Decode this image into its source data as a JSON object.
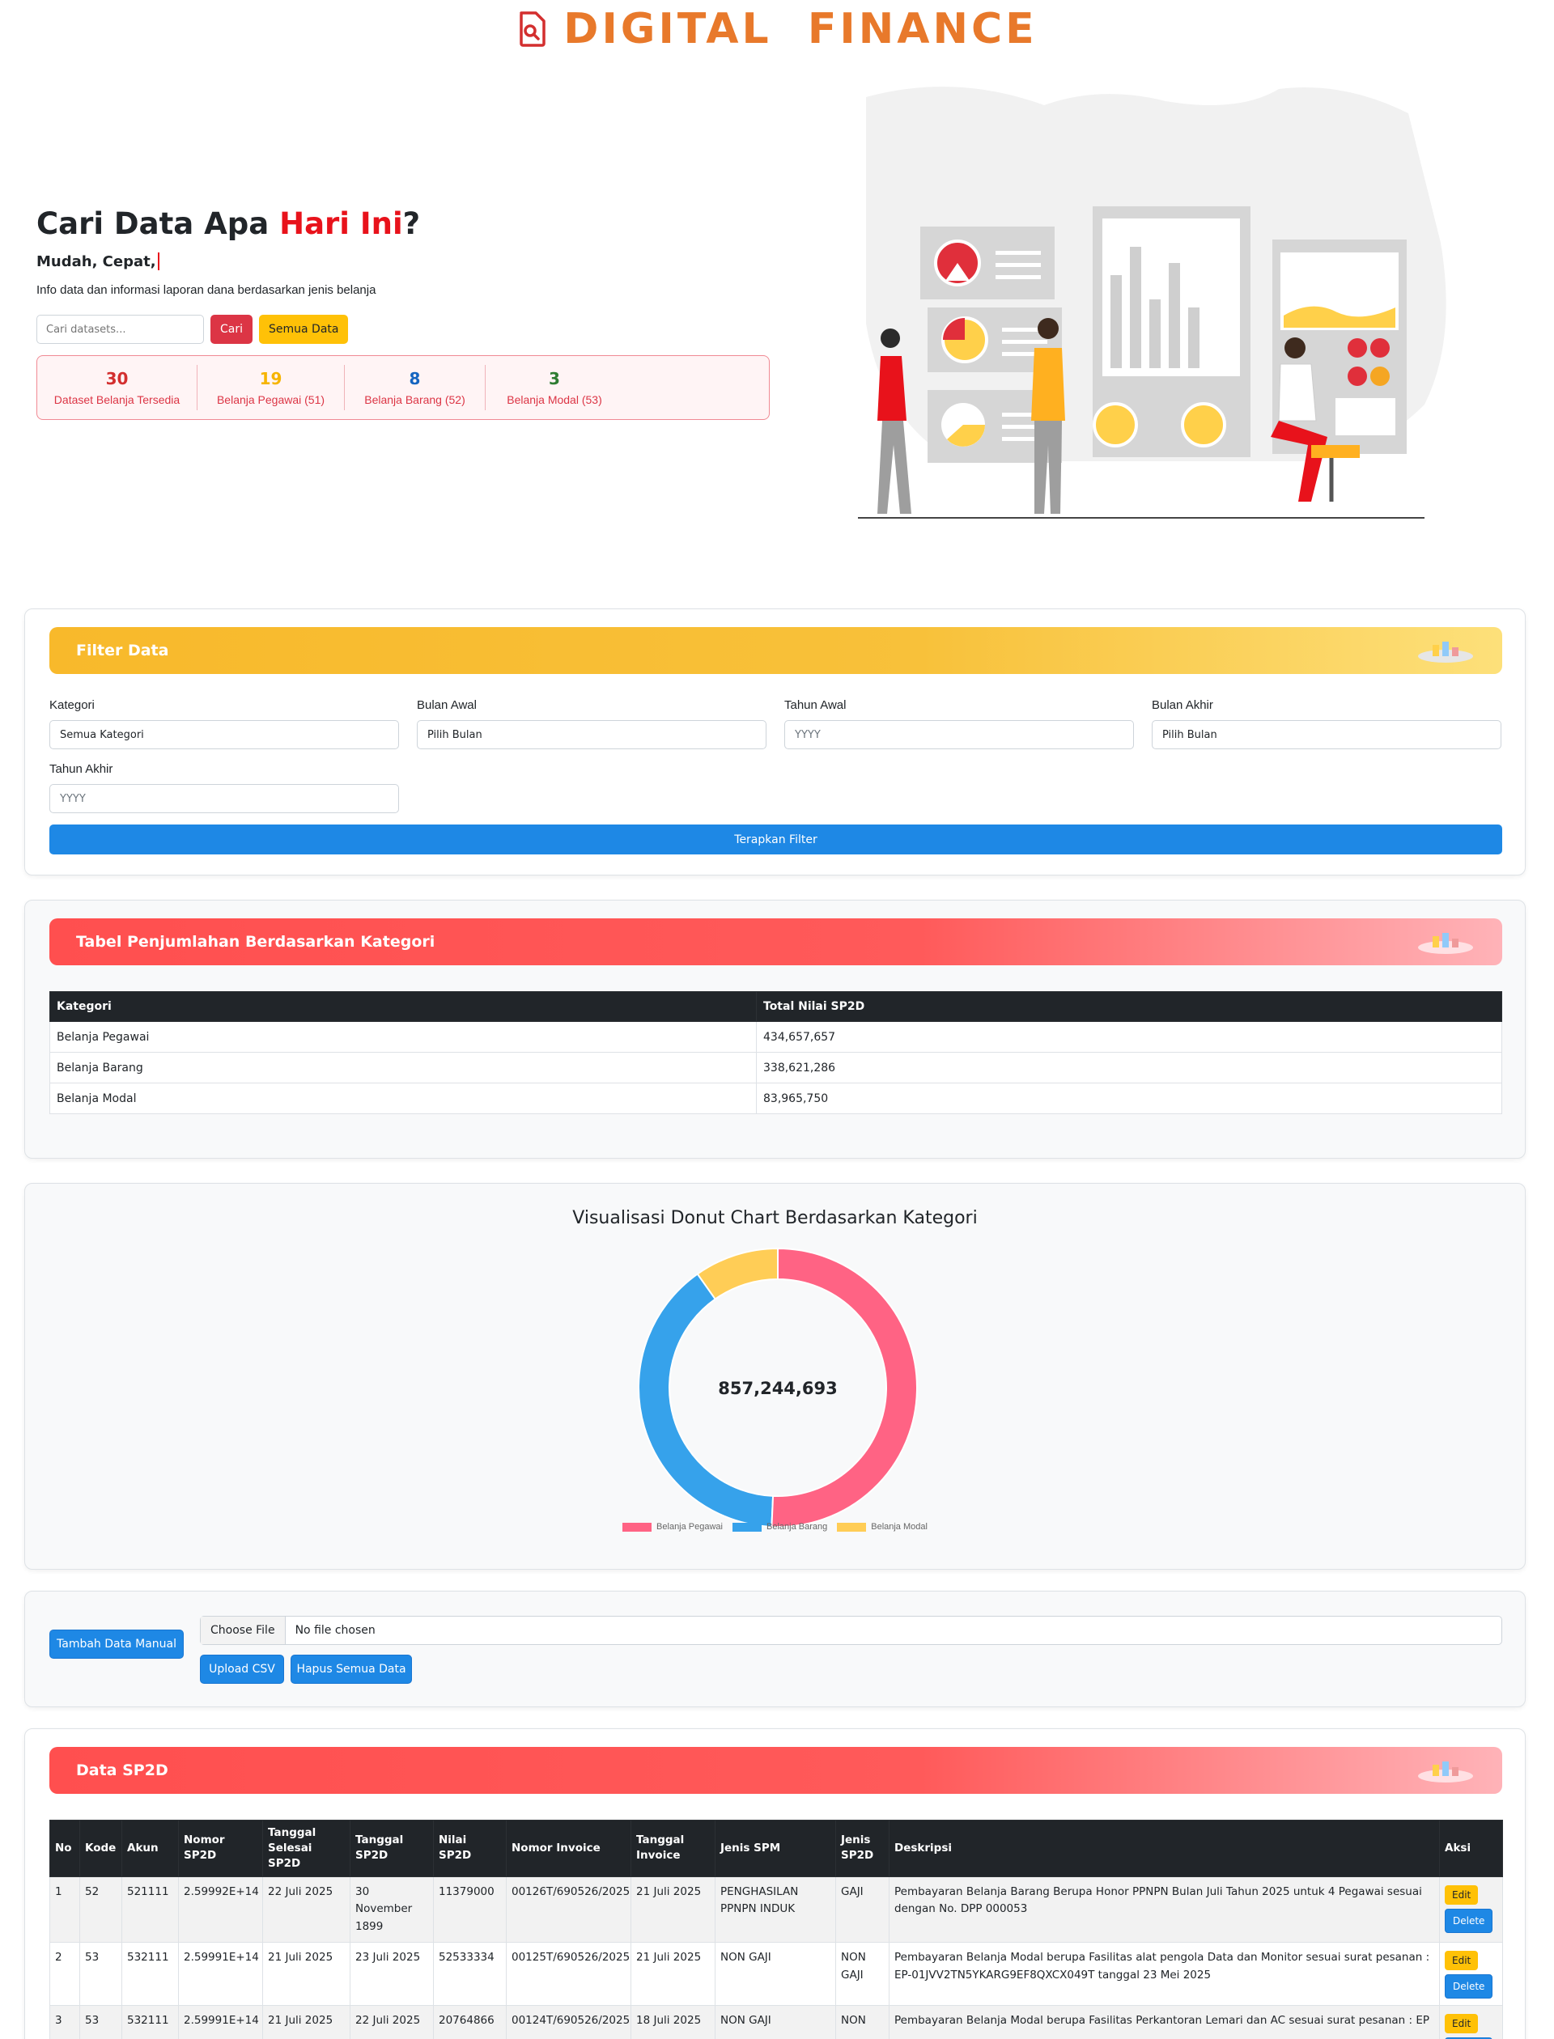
{
  "brand": {
    "title": "DIGITAL  FINANCE"
  },
  "hero": {
    "title_prefix": "Cari Data Apa ",
    "title_highlight": "Hari Ini",
    "title_suffix": "?",
    "typed_text": "Mudah, Cepat,",
    "description": "Info data dan informasi laporan dana berdasarkan jenis belanja",
    "search_placeholder": "Cari datasets...",
    "search_button": "Cari",
    "all_data_button": "Semua Data"
  },
  "stats": [
    {
      "value": "30",
      "label": "Dataset Belanja Tersedia",
      "color": "#d32f2f"
    },
    {
      "value": "19",
      "label": "Belanja Pegawai (51)",
      "color": "#f6b400"
    },
    {
      "value": "8",
      "label": "Belanja Barang (52)",
      "color": "#1565c0"
    },
    {
      "value": "3",
      "label": "Belanja Modal (53)",
      "color": "#2e7d32"
    }
  ],
  "filter": {
    "title": "Filter Data",
    "fields": {
      "kategori": {
        "label": "Kategori",
        "value": "Semua Kategori"
      },
      "bulan_awal": {
        "label": "Bulan Awal",
        "value": "Pilih Bulan"
      },
      "tahun_awal": {
        "label": "Tahun Awal",
        "placeholder": "YYYY"
      },
      "bulan_akhir": {
        "label": "Bulan Akhir",
        "value": "Pilih Bulan"
      },
      "tahun_akhir": {
        "label": "Tahun Akhir",
        "placeholder": "YYYY"
      }
    },
    "apply_button": "Terapkan Filter"
  },
  "summary": {
    "title": "Tabel Penjumlahan Berdasarkan Kategori",
    "headers": [
      "Kategori",
      "Total Nilai SP2D"
    ],
    "rows": [
      [
        "Belanja Pegawai",
        "434,657,657"
      ],
      [
        "Belanja Barang",
        "338,621,286"
      ],
      [
        "Belanja Modal",
        "83,965,750"
      ]
    ]
  },
  "donut": {
    "title": "Visualisasi Donut Chart Berdasarkan Kategori",
    "center_label": "857,244,693"
  },
  "chart_data": {
    "type": "pie",
    "title": "Visualisasi Donut Chart Berdasarkan Kategori",
    "categories": [
      "Belanja Pegawai",
      "Belanja Barang",
      "Belanja Modal"
    ],
    "values": [
      434657657,
      338621286,
      83965750
    ],
    "colors": [
      "#ff6384",
      "#36a2eb",
      "#ffcd56"
    ],
    "legend": "bottom"
  },
  "upload": {
    "add_manual_button": "Tambah Data Manual",
    "choose_file": "Choose File",
    "no_file": "No file chosen",
    "upload_button": "Upload CSV",
    "delete_all_button": "Hapus Semua Data"
  },
  "sp2d": {
    "title": "Data SP2D",
    "headers": [
      "No",
      "Kode",
      "Akun",
      "Nomor SP2D",
      "Tanggal Selesai SP2D",
      "Tanggal SP2D",
      "Nilai SP2D",
      "Nomor Invoice",
      "Tanggal Invoice",
      "Jenis SPM",
      "Jenis SP2D",
      "Deskripsi",
      "Aksi"
    ],
    "rows": [
      [
        "1",
        "52",
        "521111",
        "2.59992E+14",
        "22 Juli 2025",
        "30 November 1899",
        "11379000",
        "00126T/690526/2025",
        "21 Juli 2025",
        "PENGHASILAN PPNPN INDUK",
        "GAJI",
        "Pembayaran Belanja Barang Berupa Honor PPNPN Bulan Juli Tahun 2025 untuk 4 Pegawai sesuai dengan No. DPP 000053"
      ],
      [
        "2",
        "53",
        "532111",
        "2.59991E+14",
        "21 Juli 2025",
        "23 Juli 2025",
        "52533334",
        "00125T/690526/2025",
        "21 Juli 2025",
        "NON GAJI",
        "NON GAJI",
        "Pembayaran Belanja Modal berupa Fasilitas alat pengola Data dan Monitor sesuai surat pesanan : EP-01JVV2TN5YKARG9EF8QXCX049T tanggal 23 Mei 2025"
      ],
      [
        "3",
        "53",
        "532111",
        "2.59991E+14",
        "21 Juli 2025",
        "22 Juli 2025",
        "20764866",
        "00124T/690526/2025",
        "18 Juli 2025",
        "NON GAJI",
        "NON",
        "Pembayaran Belanja Modal berupa Fasilitas Perkantoran Lemari dan AC sesuai surat pesanan : EP"
      ]
    ],
    "edit_label": "Edit",
    "delete_label": "Delete"
  }
}
